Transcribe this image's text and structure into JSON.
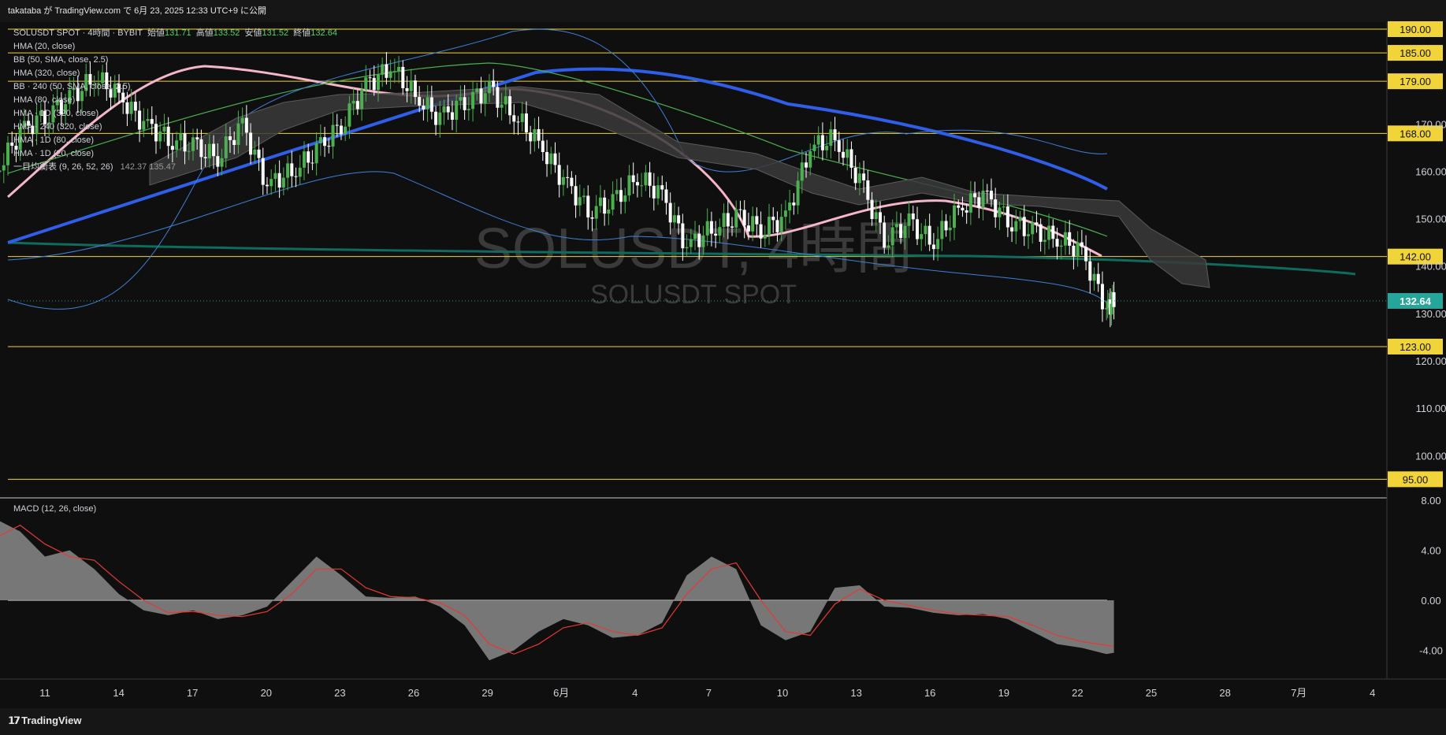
{
  "header": {
    "published": "takataba が TradingView.com で 6月 23, 2025 12:33 UTC+9 に公開"
  },
  "legend": {
    "symbol_line": "SOLUSDT SPOT · 4時間 · BYBIT",
    "open_label": "始値",
    "open": "131.71",
    "high_label": "高値",
    "high": "133.52",
    "low_label": "安値",
    "low": "131.52",
    "close_label": "終値",
    "close": "132.64",
    "indicators": [
      "HMA (20, close)",
      "BB (50, SMA, close, 2.5)",
      "HMA (320, close)",
      "BB · 240 (50, SMA, close, 2.5)",
      "HMA (80, close)",
      "HMA · 1D (320, close)",
      "HMA · 240 (320, close)",
      "HMA · 1D (80, close)",
      "HMA · 1D (20, close)",
      "一目均衡表 (9, 26, 52, 26)"
    ],
    "ichimoku_values": "142.37   135.47"
  },
  "watermark": {
    "main": "SOLUSDT, 4時間",
    "sub": "SOLUSDT SPOT"
  },
  "macd_label": "MACD (12, 26, close)",
  "brand": "TradingView",
  "colors": {
    "up": "#4caf50",
    "down": "#ffffff",
    "level": "#f0d43a",
    "hma_pink": "#f4b6c8",
    "hma_blue": "#2f5ee8",
    "hma_teal": "#0f6b5b",
    "bb": "#3f7fd6",
    "macd_area": "#8a8a8a",
    "signal": "#e53935",
    "price_tag": "#26a69a"
  },
  "chart_data": {
    "type": "candlestick",
    "title": "SOLUSDT SPOT · 4時間 · BYBIT",
    "ylim": [
      90,
      193
    ],
    "y_ticks": [
      "120.00",
      "130.00",
      "140.00",
      "150.00",
      "160.00",
      "170.00",
      "110.00",
      "100.00"
    ],
    "x_ticks": [
      "11",
      "14",
      "17",
      "20",
      "23",
      "26",
      "29",
      "6月",
      "4",
      "7",
      "10",
      "13",
      "16",
      "19",
      "22",
      "25",
      "28",
      "7月",
      "4"
    ],
    "horizontal_levels": [
      190,
      185,
      179,
      168,
      142,
      123,
      95
    ],
    "horizontal_level_labels": [
      "190.00",
      "185.00",
      "179.00",
      "168.00",
      "142.00",
      "123.00",
      "95.00"
    ],
    "last_price": 132.64,
    "last_price_label": "132.64",
    "price_path_days": [
      8,
      9,
      10,
      11,
      12,
      13,
      14,
      15,
      16,
      17,
      18,
      19,
      20,
      21,
      22,
      23,
      24,
      25,
      26,
      27,
      28,
      29,
      30,
      31,
      32,
      33,
      34,
      35,
      36,
      37,
      38,
      39,
      40,
      41,
      42,
      43,
      44,
      45,
      46,
      47,
      48,
      49,
      50,
      51,
      52,
      53,
      54,
      54.3
    ],
    "price_path_close": [
      147,
      160,
      168,
      172,
      175,
      180,
      176,
      170,
      167,
      165,
      163,
      170,
      157,
      160,
      164,
      170,
      178,
      182,
      176,
      171,
      175,
      177,
      172,
      166,
      158,
      152,
      153,
      159,
      155,
      144,
      148,
      150,
      148,
      150,
      165,
      167,
      158,
      146,
      149,
      145,
      152,
      155,
      150,
      147,
      146,
      143,
      131,
      132.64
    ],
    "macd": {
      "y_ticks": [
        "8.00",
        "4.00",
        "0.00",
        "-4.00"
      ],
      "ylim": [
        -6.5,
        8.5
      ],
      "days": [
        8,
        9,
        10,
        11,
        12,
        13,
        14,
        15,
        16,
        17,
        18,
        19,
        20,
        21,
        22,
        23,
        24,
        25,
        26,
        27,
        28,
        29,
        30,
        31,
        32,
        33,
        34,
        35,
        36,
        37,
        38,
        39,
        40,
        41,
        42,
        43,
        44,
        45,
        46,
        47,
        48,
        49,
        50,
        51,
        52,
        53,
        54,
        54.3
      ],
      "macd": [
        2,
        6.5,
        5.5,
        3.5,
        4,
        2.5,
        0.5,
        -0.8,
        -1.2,
        -0.8,
        -1.5,
        -1.2,
        -0.5,
        1.5,
        3.5,
        2,
        0.3,
        0.2,
        0.3,
        -0.5,
        -2,
        -4.8,
        -4,
        -2.5,
        -1.5,
        -2,
        -3,
        -2.8,
        -1.8,
        2,
        3.5,
        2.5,
        -2,
        -3.2,
        -2.5,
        1,
        1.2,
        -0.5,
        -0.6,
        -1,
        -1.2,
        -1.1,
        -1.5,
        -2.5,
        -3.5,
        -3.8,
        -4.3,
        -4.2
      ],
      "signal": [
        1.5,
        5,
        6,
        4.5,
        3.5,
        3.2,
        1.5,
        0,
        -1,
        -0.9,
        -1.2,
        -1.3,
        -0.9,
        0.5,
        2.5,
        2.5,
        1,
        0.3,
        0.2,
        -0.2,
        -1.2,
        -3.5,
        -4.3,
        -3.5,
        -2.2,
        -1.8,
        -2.5,
        -2.8,
        -2.2,
        0.5,
        2.5,
        3,
        0,
        -2.5,
        -2.8,
        -0.3,
        0.9,
        0,
        -0.4,
        -0.8,
        -1.1,
        -1.2,
        -1.3,
        -2,
        -2.8,
        -3.3,
        -3.6,
        -3.7
      ]
    }
  }
}
